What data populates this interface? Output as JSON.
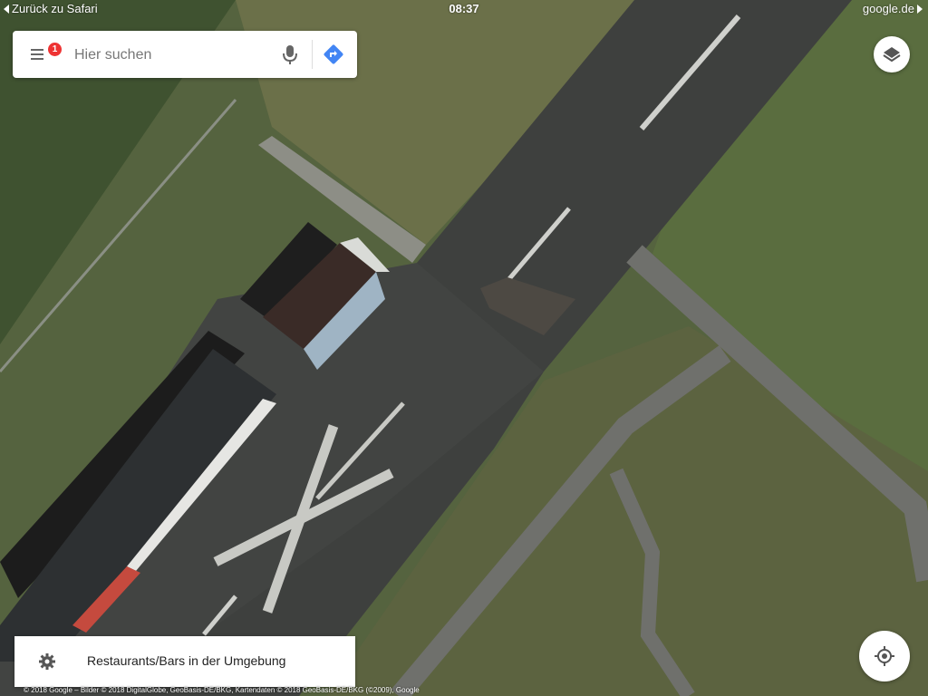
{
  "status_bar": {
    "back_label": "Zurück zu Safari",
    "time": "08:37",
    "host": "google.de"
  },
  "search": {
    "placeholder": "Hier suchen",
    "notification_count": "1",
    "menu_icon": "hamburger-menu-icon",
    "mic_icon": "microphone-icon",
    "directions_icon": "directions-icon",
    "directions_color": "#4285f4",
    "badge_color": "#e33333"
  },
  "layers": {
    "icon": "layers-icon"
  },
  "explore": {
    "label": "Restaurants/Bars in der Umgebung",
    "icon": "gear-icon"
  },
  "locate": {
    "icon": "my-location-icon"
  },
  "copyright": "© 2018 Google – Bilder © 2018 DigitalGlobe, GeoBasis-DE/BKG, Kartendaten © 2018 GeoBasis-DE/BKG (©2009), Google",
  "map": {
    "view": "satellite"
  }
}
